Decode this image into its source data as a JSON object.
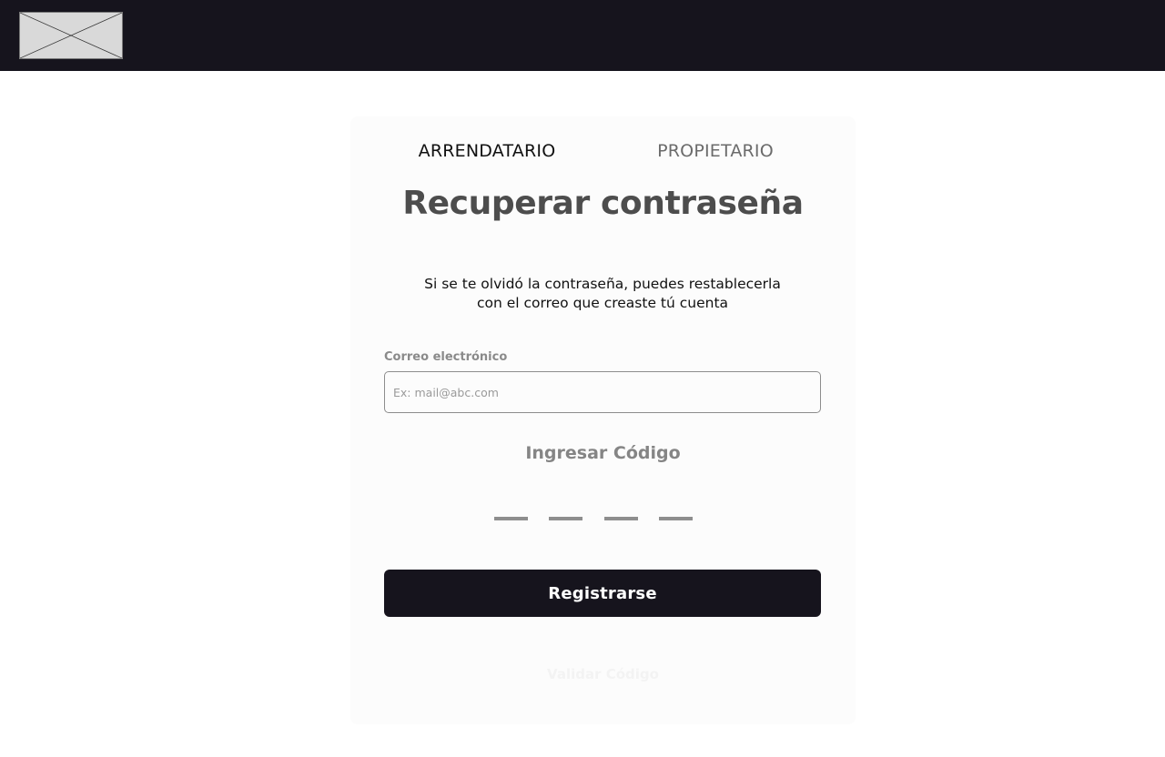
{
  "header": {
    "logo_icon": "image-placeholder-icon"
  },
  "tabs": [
    {
      "label": "ARRENDATARIO",
      "active": true
    },
    {
      "label": "PROPIETARIO",
      "active": false
    }
  ],
  "form": {
    "title": "Recuperar contraseña",
    "description_line1": "Si se te olvidó la contraseña, puedes restablecerla",
    "description_line2": "con el correo que creaste tú cuenta",
    "email_label": "Correo electrónico",
    "email_placeholder": "Ex: mail@abc.com",
    "email_value": "",
    "code_title": "Ingresar Código",
    "submit_label": "Registrarse",
    "resend_label": "Validar Código"
  },
  "colors": {
    "topbar": "#16141d",
    "button": "#16141d",
    "card": "#fcfcfc",
    "title": "#4d4d4d"
  }
}
